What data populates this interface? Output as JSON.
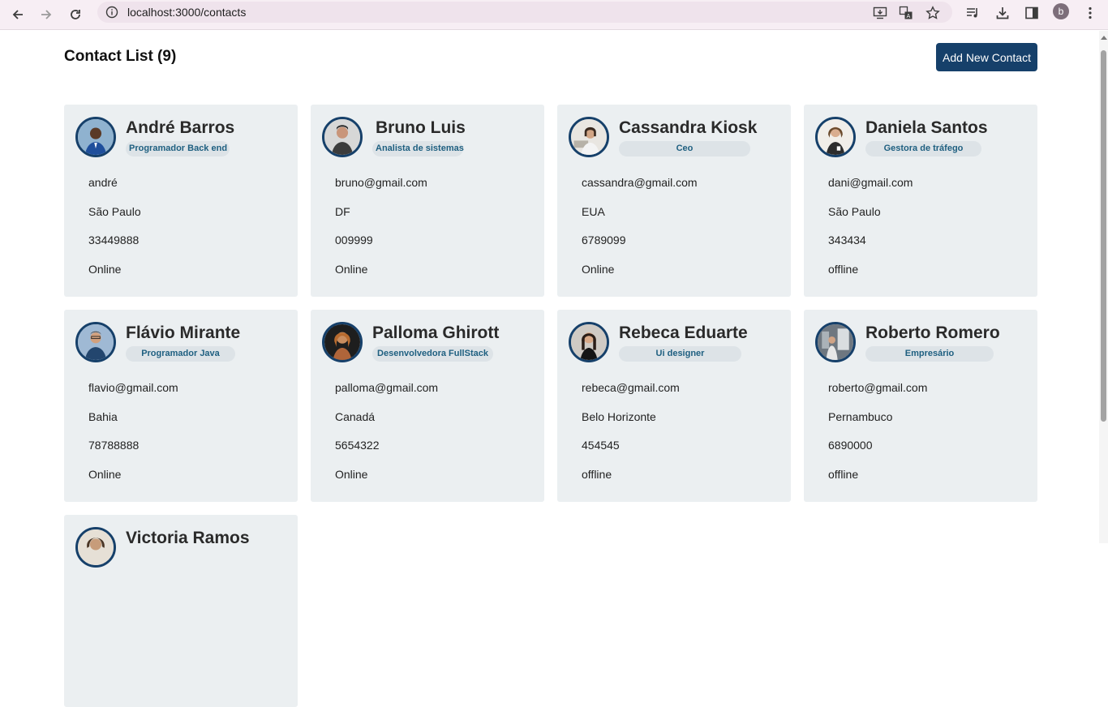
{
  "browser": {
    "url": "localhost:3000/contacts",
    "profile_initial": "b"
  },
  "page": {
    "title": "Contact List (9)",
    "add_button_label": "Add New Contact"
  },
  "contacts": [
    {
      "name": "André Barros",
      "role": "Programador Back end",
      "email": "andré",
      "location": "São Paulo",
      "phone": "33449888",
      "status": "Online"
    },
    {
      "name": "Bruno Luis",
      "role": "Analista de sistemas",
      "email": "bruno@gmail.com",
      "location": "DF",
      "phone": "009999",
      "status": "Online"
    },
    {
      "name": "Cassandra Kiosk",
      "role": "Ceo",
      "email": "cassandra@gmail.com",
      "location": "EUA",
      "phone": "6789099",
      "status": "Online"
    },
    {
      "name": "Daniela Santos",
      "role": "Gestora de tráfego",
      "email": "dani@gmail.com",
      "location": "São Paulo",
      "phone": "343434",
      "status": "offline"
    },
    {
      "name": "Flávio Mirante",
      "role": "Programador Java",
      "email": "flavio@gmail.com",
      "location": "Bahia",
      "phone": "78788888",
      "status": "Online"
    },
    {
      "name": "Palloma Ghirott",
      "role": "Desenvolvedora FullStack",
      "email": "palloma@gmail.com",
      "location": "Canadá",
      "phone": "5654322",
      "status": "Online"
    },
    {
      "name": "Rebeca Eduarte",
      "role": "Ui designer",
      "email": "rebeca@gmail.com",
      "location": "Belo Horizonte",
      "phone": "454545",
      "status": "offline"
    },
    {
      "name": "Roberto Romero",
      "role": "Empresário",
      "email": "roberto@gmail.com",
      "location": "Pernambuco",
      "phone": "6890000",
      "status": "offline"
    },
    {
      "name": "Victoria Ramos",
      "role": "",
      "email": "",
      "location": "",
      "phone": "",
      "status": ""
    }
  ],
  "colors": {
    "accent": "#16406a",
    "card_bg": "#ebeff1",
    "role_text": "#1e5f80",
    "role_bg": "#dde3e7"
  },
  "icons": {
    "back": "arrow-left-icon",
    "forward": "arrow-right-icon",
    "reload": "reload-icon",
    "site_info": "site-info-icon",
    "install": "install-app-icon",
    "translate": "translate-icon",
    "bookmark": "star-icon",
    "media": "media-controls-icon",
    "downloads": "download-icon",
    "side_panel": "side-panel-icon",
    "menu": "kebab-menu-icon"
  }
}
